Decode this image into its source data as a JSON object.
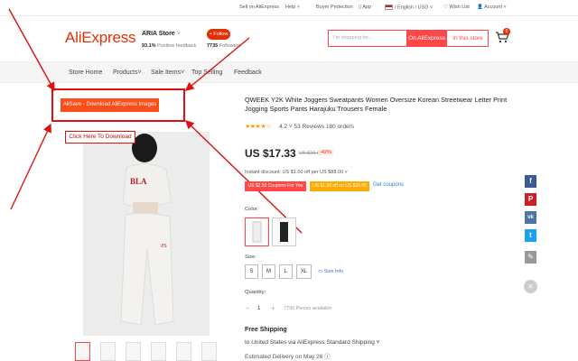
{
  "topbar": {
    "sell": "Sell on AliExpress",
    "help": "Help",
    "buyer_protection": "Buyer Protection",
    "app": "App",
    "language": "/ English / USD",
    "wishlist": "Wish List",
    "account": "Account"
  },
  "header": {
    "logo": "AliExpress",
    "store_name": "ARIA Store",
    "feedback_value": "93.1%",
    "feedback_label": "Positive feedback",
    "follow": "+ Follow",
    "followers_value": "7735",
    "followers_label": "Followers",
    "search_placeholder": "I'm shopping for...",
    "search_ae": "On AliExpress",
    "search_store": "In this store",
    "cart_count": "0"
  },
  "nav": {
    "items": [
      "Store Home",
      "Products",
      "Sale Items",
      "Top Selling",
      "Feedback"
    ]
  },
  "overlay": {
    "alisave": "AliSave - Download AliExpress Images",
    "click_download": "Click Here To Download"
  },
  "product": {
    "title": "QWEEK Y2K White Joggers Sweatpants Women Oversize Korean Streetwear Letter Print Jogging Sports Pants Harajuku Trousers Female",
    "rating": "4.2",
    "reviews": "53 Reviews",
    "orders": "180 orders",
    "price": "US $17.33",
    "old_price": "US $29.88",
    "discount": "-42%",
    "instant_discount": "Instant discount: US $1.00 off per US $88.00",
    "coupon1": "US $2.50 Coupons For You",
    "coupon2": "US $1.00 off on US $39.00",
    "get_coupons": "Get coupons",
    "color_label": "Color:",
    "size_label": "Size:",
    "sizes": [
      "S",
      "M",
      "L",
      "XL"
    ],
    "size_info": "Size Info",
    "quantity_label": "Quantity:",
    "quantity": "1",
    "pieces": "7790 Pieces available",
    "free_shipping": "Free Shipping",
    "ship_to": "to United States via AliExpress Standard Shipping",
    "estimated": "Estimated Delivery on May 26"
  },
  "colors": {
    "accent": "#e62e04",
    "annotation": "#e01010"
  }
}
